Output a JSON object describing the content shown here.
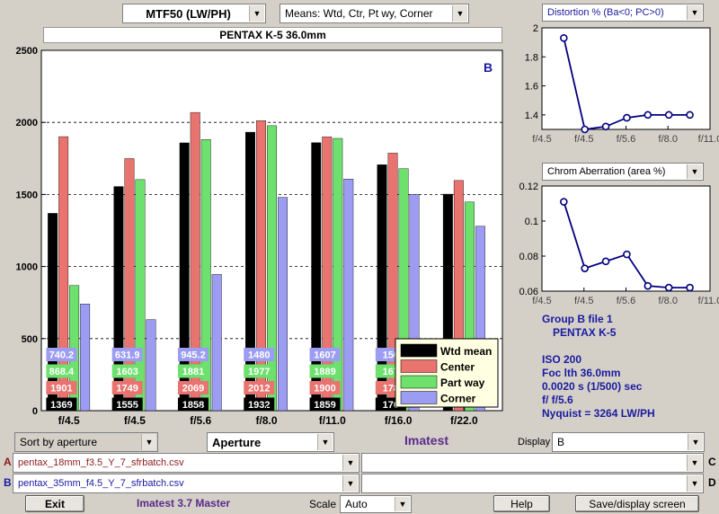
{
  "top": {
    "metric_select": "MTF50 (LW/PH)",
    "means_select": "Means: Wtd, Ctr, Pt wy, Corner",
    "title_box": "PENTAX K-5    36.0mm"
  },
  "chart_data": {
    "type": "bar",
    "group_label": "B",
    "categories": [
      "f/4.5",
      "f/4.5",
      "f/5.6",
      "f/8.0",
      "f/11.0",
      "f/16.0",
      "f/22.0"
    ],
    "ylim": [
      0,
      2500
    ],
    "yticks": [
      "0",
      "500",
      "1000",
      "1500",
      "2000",
      "2500"
    ],
    "series": [
      {
        "name": "Wtd mean",
        "color": "#000000",
        "values": [
          1369,
          1555,
          1858,
          1932,
          1859,
          1706,
          1502
        ],
        "labels": [
          "1369",
          "1555",
          "1858",
          "1932",
          "1859",
          "170",
          ""
        ]
      },
      {
        "name": "Center",
        "color": "#e8736f",
        "values": [
          1901,
          1749,
          2069,
          2012,
          1900,
          1787,
          1597
        ],
        "labels": [
          "1901",
          "1749",
          "2069",
          "2012",
          "1900",
          "178",
          ""
        ]
      },
      {
        "name": "Part way",
        "color": "#6ee06e",
        "values": [
          868.4,
          1603,
          1881,
          1977,
          1889,
          1679,
          1448
        ],
        "labels": [
          "868.4",
          "1603",
          "1881",
          "1977",
          "1889",
          "167",
          ""
        ]
      },
      {
        "name": "Corner",
        "color": "#9c9cf2",
        "values": [
          740.2,
          631.9,
          945.2,
          1480,
          1607,
          1500,
          1280
        ],
        "labels": [
          "740.2",
          "631.9",
          "945.2",
          "1480",
          "1607",
          "150",
          ""
        ]
      }
    ],
    "grid": "dashed-horizontal",
    "legend_position": "bottom-right"
  },
  "distortion": {
    "select": "Distortion %  (Ba<0; PC>0)",
    "type": "line",
    "x_ticks": [
      "f/4.5",
      "f/4.5",
      "f/5.6",
      "f/8.0",
      "f/11.0"
    ],
    "y_ticks": [
      "1.4",
      "1.6",
      "1.8",
      "2"
    ],
    "ylim": [
      1.3,
      2.0
    ],
    "values": [
      1.93,
      1.3,
      1.32,
      1.38,
      1.4,
      1.4,
      1.4
    ]
  },
  "chrom": {
    "select": "Chrom Aberration (area %)",
    "type": "line",
    "x_ticks": [
      "f/4.5",
      "f/4.5",
      "f/5.6",
      "f/8.0",
      "f/11.0"
    ],
    "y_ticks": [
      "0.06",
      "0.08",
      "0.1",
      "0.12"
    ],
    "ylim": [
      0.06,
      0.12
    ],
    "values": [
      0.111,
      0.073,
      0.077,
      0.081,
      0.063,
      0.062,
      0.062
    ]
  },
  "info": {
    "line1": "Group B file 1",
    "line2": "PENTAX K-5",
    "line3": "ISO  200",
    "line4": "Foc lth  36.0mm",
    "line5": "0.0020 s  (1/500)  sec",
    "line6": "f/  f/5.6",
    "line7": "Nyquist = 3264 LW/PH"
  },
  "controls": {
    "sort_select": "Sort by aperture",
    "aperture_select": "Aperture",
    "brand": "Imatest",
    "display_label": "Display",
    "display_select": "B",
    "row_a_label": "A",
    "row_a_file": "pentax_18mm_f3.5_Y_7_sfrbatch.csv",
    "row_b_label": "B",
    "row_b_file": "pentax_35mm_f4.5_Y_7_sfrbatch.csv",
    "row_c_label": "C",
    "row_d_label": "D",
    "exit_button": "Exit",
    "version": "Imatest 3.7 Master",
    "scale_label": "Scale",
    "scale_select": "Auto",
    "help_button": "Help",
    "save_button": "Save/display screen"
  },
  "colors": {
    "label_blue": "#1a1aa0",
    "brand_purple": "#5a2a8a",
    "line_blue": "#000080"
  }
}
